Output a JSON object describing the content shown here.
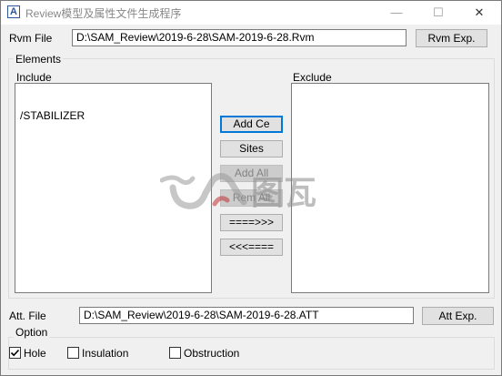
{
  "window": {
    "title": "Review模型及属性文件生成程序",
    "icon_letter": "A",
    "controls": {
      "minimize": "—",
      "maximize": "☐",
      "close": "✕"
    }
  },
  "rvm": {
    "label": "Rvm File",
    "value": "D:\\SAM_Review\\2019-6-28\\SAM-2019-6-28.Rvm",
    "button": "Rvm Exp."
  },
  "elements": {
    "group_label": "Elements",
    "include_label": "Include",
    "exclude_label": "Exclude",
    "include_items": [
      "/STABILIZER"
    ],
    "exclude_items": []
  },
  "buttons": {
    "add_ce": "Add  Ce",
    "sites": "Sites",
    "add_all": "Add All",
    "rem_all": "Rem All",
    "move_right": "====>>>",
    "move_left": "<<<===="
  },
  "att": {
    "label": "Att. File",
    "value": "D:\\SAM_Review\\2019-6-28\\SAM-2019-6-28.ATT",
    "button": "Att Exp."
  },
  "option": {
    "group_label": "Option",
    "items": [
      {
        "label": "Hole",
        "checked": true
      },
      {
        "label": "Insulation",
        "checked": false
      },
      {
        "label": "Obstruction",
        "checked": false
      }
    ]
  },
  "watermark": {
    "text": "图瓦"
  },
  "colors": {
    "accent": "#0078d7",
    "window_bg": "#f0f0f0"
  }
}
